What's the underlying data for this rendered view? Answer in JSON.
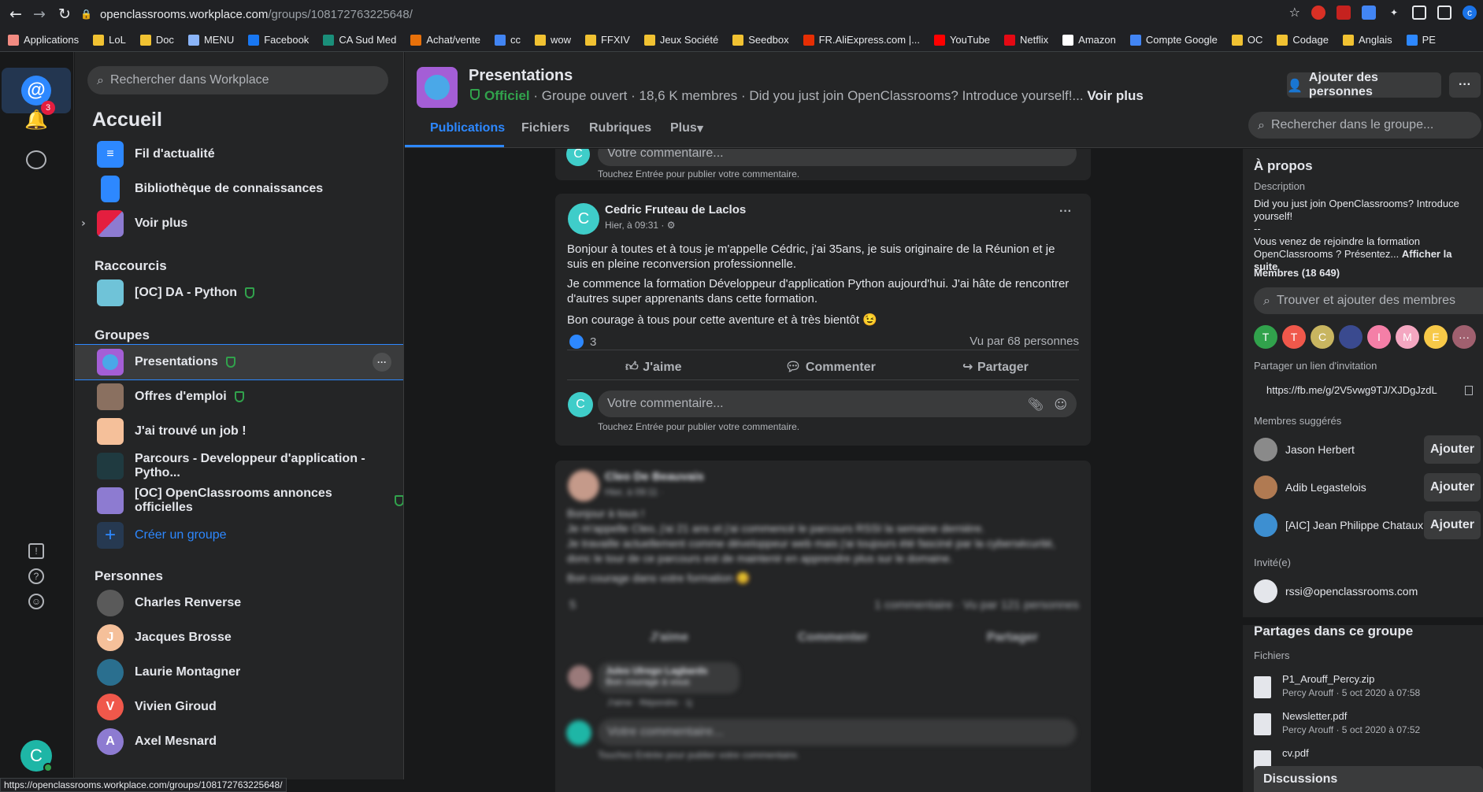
{
  "browser": {
    "url_host": "openclassrooms.workplace.com",
    "url_path": "/groups/108172763225648/",
    "status_url": "https://openclassrooms.workplace.com/groups/108172763225648/"
  },
  "bookmarks": [
    {
      "label": "Applications",
      "icon": "apps-grid-icon",
      "color": "#f28b82"
    },
    {
      "label": "LoL",
      "icon": "folder-icon",
      "color": "#f1c232"
    },
    {
      "label": "Doc",
      "icon": "folder-icon",
      "color": "#f1c232"
    },
    {
      "label": "MENU",
      "icon": "page-icon",
      "color": "#8ab4f8"
    },
    {
      "label": "Facebook",
      "icon": "facebook-icon",
      "color": "#1877f2"
    },
    {
      "label": "CA Sud Med",
      "icon": "bank-icon",
      "color": "#1a8f7a"
    },
    {
      "label": "Achat/vente",
      "icon": "shop-icon",
      "color": "#e8710a"
    },
    {
      "label": "cc",
      "icon": "google-icon",
      "color": "#4285f4"
    },
    {
      "label": "wow",
      "icon": "folder-icon",
      "color": "#f1c232"
    },
    {
      "label": "FFXIV",
      "icon": "folder-icon",
      "color": "#f1c232"
    },
    {
      "label": "Jeux Société",
      "icon": "folder-icon",
      "color": "#f1c232"
    },
    {
      "label": "Seedbox",
      "icon": "folder-icon",
      "color": "#f1c232"
    },
    {
      "label": "FR.AliExpress.com |...",
      "icon": "aliexpress-icon",
      "color": "#e62e04"
    },
    {
      "label": "YouTube",
      "icon": "youtube-icon",
      "color": "#ff0000"
    },
    {
      "label": "Netflix",
      "icon": "netflix-icon",
      "color": "#e50914"
    },
    {
      "label": "Amazon",
      "icon": "amazon-icon",
      "color": "#ffffff"
    },
    {
      "label": "Compte Google",
      "icon": "google-icon",
      "color": "#4285f4"
    },
    {
      "label": "OC",
      "icon": "folder-icon",
      "color": "#f1c232"
    },
    {
      "label": "Codage",
      "icon": "folder-icon",
      "color": "#f1c232"
    },
    {
      "label": "Anglais",
      "icon": "folder-icon",
      "color": "#f1c232"
    },
    {
      "label": "PE",
      "icon": "edge-icon",
      "color": "#2d88ff"
    }
  ],
  "rail": {
    "notif_count": "3",
    "avatar_letter": "C"
  },
  "sidebar": {
    "search_placeholder": "Rechercher dans Workplace",
    "title": "Accueil",
    "home": [
      {
        "label": "Fil d'actualité"
      },
      {
        "label": "Bibliothèque de connaissances"
      },
      {
        "label": "Voir plus"
      }
    ],
    "shortcuts_title": "Raccourcis",
    "shortcuts": [
      {
        "label": "[OC] DA - Python"
      }
    ],
    "groups_title": "Groupes",
    "groups": [
      {
        "label": "Presentations"
      },
      {
        "label": "Offres d'emploi"
      },
      {
        "label": "J'ai trouvé un job !"
      },
      {
        "label": "Parcours - Developpeur d'application - Pytho..."
      },
      {
        "label": "[OC] OpenClassrooms annonces officielles"
      }
    ],
    "create_group": "Créer un groupe",
    "people_title": "Personnes",
    "people": [
      {
        "label": "Charles Renverse",
        "letter": "",
        "color": "#5a5a5a"
      },
      {
        "label": "Jacques Brosse",
        "letter": "J",
        "color": "#f5c09a"
      },
      {
        "label": "Laurie Montagner",
        "letter": "",
        "color": "#2a6f8f"
      },
      {
        "label": "Vivien Giroud",
        "letter": "V",
        "color": "#f0584b"
      },
      {
        "label": "Axel Mesnard",
        "letter": "A",
        "color": "#8d7bd1"
      }
    ]
  },
  "group": {
    "name": "Presentations",
    "official": "Officiel",
    "meta": " · Groupe ouvert · 18,6 K membres · Did you just join OpenClassrooms? Introduce yourself!...",
    "see_more": "Voir plus",
    "add_people": "Ajouter des personnes",
    "more": "···",
    "search_placeholder": "Rechercher dans le groupe...",
    "tabs": [
      {
        "label": "Publications"
      },
      {
        "label": "Fichiers"
      },
      {
        "label": "Rubriques"
      },
      {
        "label": "Plus"
      }
    ]
  },
  "feed": {
    "top_comment_placeholder": "Votre commentaire...",
    "top_hint": "Touchez Entrée pour publier votre commentaire.",
    "post": {
      "author": "Cedric Fruteau de Laclos",
      "avatar_letter": "C",
      "time": "Hier, à 09:31 · ",
      "p1": "Bonjour à toutes et à tous je m'appelle Cédric, j'ai 35ans, je suis originaire de la Réunion et je suis en pleine reconversion professionnelle.",
      "p2": "Je commence la formation Développeur d'application Python aujourd'hui. J'ai hâte de rencontrer d'autres super apprenants dans cette formation.",
      "p3": "Bon courage à tous pour cette aventure et à très bientôt 😉",
      "likes": "3",
      "seen": "Vu par 68 personnes",
      "like": "J'aime",
      "comment": "Commenter",
      "share": "Partager",
      "comment_placeholder": "Votre commentaire...",
      "hint": "Touchez Entrée pour publier votre commentaire.",
      "avatar_reply": "C"
    },
    "blurred": {
      "author": "Cleo De Beauvais",
      "time": "Hier, à 09:11 ·",
      "p1": "Bonjour à tous !",
      "p2": "Je m'appelle Cleo, j'ai 21 ans et j'ai commencé le parcours RSSI la semaine dernière.",
      "p3": "Je travaille actuellement comme développeur web mais j'ai toujours été fasciné par la cybersécurité, donc le tour de ce parcours est de maintenir en apprendre plus sur le domaine.",
      "p4": "Bon courage dans votre formation 😊",
      "likes": "5",
      "stats": "1 commentaire · Vu par 121 personnes",
      "like": "J'aime",
      "comment": "Commenter",
      "share": "Partager",
      "reply_author": "Jules Ulrego Lagbards",
      "reply_text": "Bon courage à vous",
      "reply_actions": "J'aime · Répondre · 1j",
      "comment_placeholder": "Votre commentaire...",
      "hint": "Touchez Entrée pour publier votre commentaire."
    }
  },
  "about": {
    "title": "À propos",
    "desc_label": "Description",
    "desc1": "Did you just join OpenClassrooms? Introduce yourself!",
    "desc2": "--",
    "desc3": "Vous venez de rejoindre la formation OpenClassrooms ? Présentez...",
    "desc_more": "Afficher la suite",
    "members": "Membres (18 649)",
    "member_search": "Trouver et ajouter des membres",
    "member_avatars": [
      {
        "letter": "T",
        "color": "#31a24c"
      },
      {
        "letter": "T",
        "color": "#f0584b"
      },
      {
        "letter": "C",
        "color": "#c8b560"
      },
      {
        "letter": "",
        "color": "#3a4a8f"
      },
      {
        "letter": "I",
        "color": "#f47fa7"
      },
      {
        "letter": "M",
        "color": "#f4a7c1"
      },
      {
        "letter": "E",
        "color": "#f7c948"
      },
      {
        "letter": "···",
        "color": "#a0606f"
      }
    ],
    "invite_label": "Partager un lien d'invitation",
    "invite_link": "https://fb.me/g/2V5vwg9TJ/XJDgJzdL",
    "suggested_label": "Membres suggérés",
    "suggested": [
      {
        "name": "Jason Herbert",
        "btn": "Ajouter",
        "color": "#8a8a8a"
      },
      {
        "name": "Adib Legastelois",
        "btn": "Ajouter",
        "color": "#b07a52"
      },
      {
        "name": "[AIC] Jean Philippe Chataux",
        "btn": "Ajouter",
        "color": "#3d8fd1"
      }
    ],
    "invited_label": "Invité(e)",
    "invited": "rssi@openclassrooms.com",
    "shares_title": "Partages dans ce groupe",
    "files_label": "Fichiers",
    "files": [
      {
        "name": "P1_Arouff_Percy.zip",
        "meta": "Percy Arouff · 5 oct 2020 à 07:58"
      },
      {
        "name": "Newsletter.pdf",
        "meta": "Percy Arouff · 5 oct 2020 à 07:52"
      },
      {
        "name": "cv.pdf",
        "meta": ""
      }
    ],
    "discussions": "Discussions"
  }
}
